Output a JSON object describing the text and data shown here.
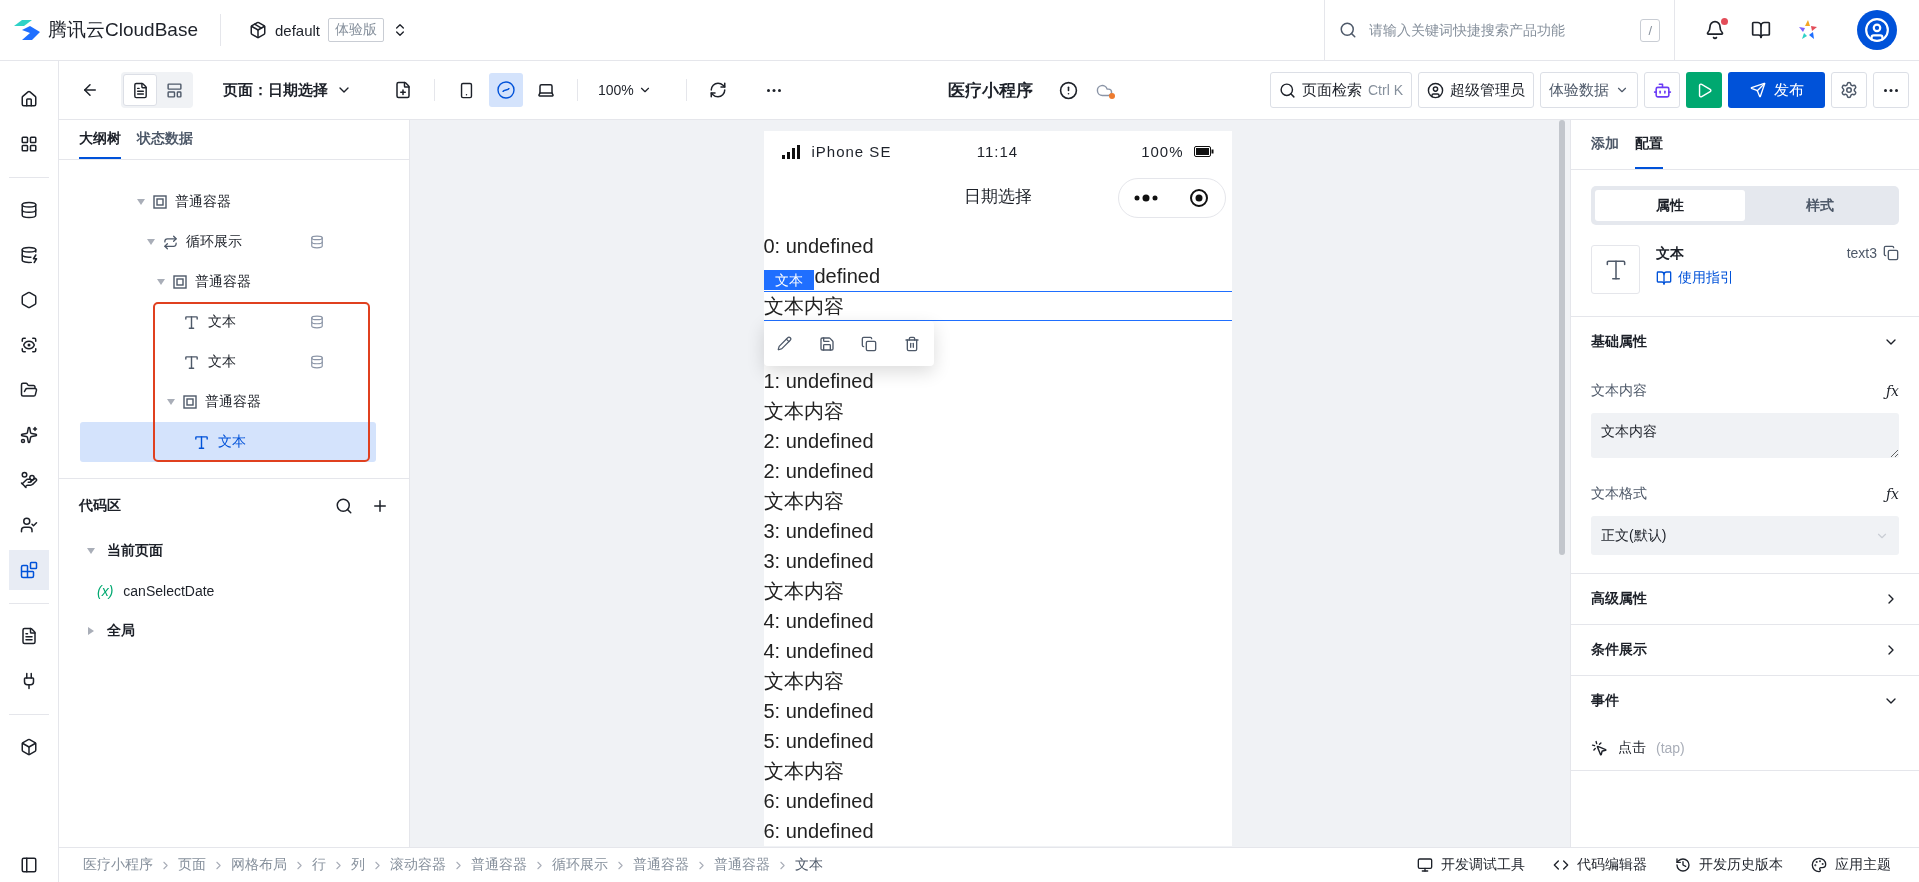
{
  "header": {
    "brand": "腾讯云CloudBase",
    "env": "default",
    "env_badge": "体验版",
    "search": {
      "placeholder": "请输入关键词快捷搜索产品功能",
      "shortcut": "/"
    },
    "notifications_unread": true
  },
  "rail_items": [
    {
      "selected": false
    },
    {
      "selected": false
    },
    {
      "selected": false
    },
    {
      "selected": false
    },
    {
      "selected": false
    },
    {
      "selected": false
    },
    {
      "selected": false
    },
    {
      "selected": false
    },
    {
      "selected": false
    },
    {
      "selected": false
    },
    {
      "selected": true
    },
    {
      "selected": false
    },
    {
      "selected": false
    },
    {
      "selected": false
    }
  ],
  "toolbar": {
    "view_modes": [
      {
        "selected": true
      },
      {
        "selected": false
      }
    ],
    "page_label": "页面：日期选择",
    "devices": [
      {
        "selected": false
      },
      {
        "selected": true
      },
      {
        "selected": false
      }
    ],
    "zoom": "100%",
    "app_title": "医疗小程序",
    "unsaved": true,
    "page_search": {
      "label": "页面检索",
      "shortcut": "Ctrl K"
    },
    "role": "超级管理员",
    "data_source": "体验数据",
    "publish": "发布"
  },
  "outline": {
    "tabs": [
      {
        "label": "大纲树",
        "selected": true
      },
      {
        "label": "状态数据",
        "selected": false
      }
    ],
    "tree": [
      {
        "label": "普通容器",
        "kind": "container",
        "expanded": true,
        "bound": false,
        "selected": false,
        "children": [
          {
            "label": "循环展示",
            "kind": "loop",
            "expanded": true,
            "bound": true,
            "selected": false,
            "children": [
              {
                "label": "普通容器",
                "kind": "container",
                "expanded": true,
                "bound": false,
                "selected": false,
                "annotated": true,
                "children": [
                  {
                    "label": "文本",
                    "kind": "text",
                    "bound": true,
                    "selected": false
                  },
                  {
                    "label": "文本",
                    "kind": "text",
                    "bound": true,
                    "selected": false
                  },
                  {
                    "label": "普通容器",
                    "kind": "container",
                    "expanded": true,
                    "bound": false,
                    "selected": false,
                    "children": [
                      {
                        "label": "文本",
                        "kind": "text",
                        "bound": false,
                        "selected": true
                      }
                    ]
                  }
                ]
              }
            ]
          }
        ]
      }
    ]
  },
  "code_area": {
    "title": "代码区",
    "groups": [
      {
        "label": "当前页面",
        "expanded": true,
        "items": [
          {
            "symbol": "(x)",
            "name": "canSelectDate"
          }
        ]
      },
      {
        "label": "全局",
        "expanded": false
      }
    ]
  },
  "canvas": {
    "device": "iPhone SE",
    "time": "11:14",
    "battery": "100%",
    "page_title": "日期选择",
    "selection_label": "文本",
    "rows": [
      {
        "text": "0: undefined",
        "selected": false
      },
      {
        "text": "defined",
        "selected": false
      },
      {
        "text": "文本内容",
        "selected": true
      },
      {
        "text": "1: undefined",
        "selected": false
      },
      {
        "text": "文本内容",
        "selected": false
      },
      {
        "text": "2: undefined",
        "selected": false
      },
      {
        "text": "2: undefined",
        "selected": false
      },
      {
        "text": "文本内容",
        "selected": false
      },
      {
        "text": "3: undefined",
        "selected": false
      },
      {
        "text": "3: undefined",
        "selected": false
      },
      {
        "text": "文本内容",
        "selected": false
      },
      {
        "text": "4: undefined",
        "selected": false
      },
      {
        "text": "4: undefined",
        "selected": false
      },
      {
        "text": "文本内容",
        "selected": false
      },
      {
        "text": "5: undefined",
        "selected": false
      },
      {
        "text": "5: undefined",
        "selected": false
      },
      {
        "text": "文本内容",
        "selected": false
      },
      {
        "text": "6: undefined",
        "selected": false
      },
      {
        "text": "6: undefined",
        "selected": false
      }
    ]
  },
  "inspector": {
    "tabs": [
      {
        "label": "添加",
        "selected": false
      },
      {
        "label": "配置",
        "selected": true
      }
    ],
    "modes": [
      {
        "label": "属性",
        "selected": true
      },
      {
        "label": "样式",
        "selected": false
      }
    ],
    "component": {
      "name": "文本",
      "guide": "使用指引",
      "id": "text3"
    },
    "sections": [
      {
        "title": "基础属性",
        "expanded": true,
        "fields": [
          {
            "kind": "textarea",
            "label": "文本内容",
            "formula": "ƒx",
            "value": "文本内容"
          },
          {
            "kind": "select",
            "label": "文本格式",
            "formula": "ƒx",
            "value": "正文(默认)"
          }
        ]
      },
      {
        "title": "高级属性",
        "expanded": false
      },
      {
        "title": "条件展示",
        "expanded": false
      },
      {
        "title": "事件",
        "expanded": true,
        "events": [
          {
            "label": "点击",
            "hint": "(tap)"
          }
        ]
      }
    ]
  },
  "bottom_bar": {
    "breadcrumb": [
      {
        "label": "医疗小程序",
        "selected": false
      },
      {
        "label": "页面",
        "selected": false
      },
      {
        "label": "网格布局",
        "selected": false
      },
      {
        "label": "行",
        "selected": false
      },
      {
        "label": "列",
        "selected": false
      },
      {
        "label": "滚动容器",
        "selected": false
      },
      {
        "label": "普通容器",
        "selected": false
      },
      {
        "label": "循环展示",
        "selected": false
      },
      {
        "label": "普通容器",
        "selected": false
      },
      {
        "label": "普通容器",
        "selected": false
      },
      {
        "label": "文本",
        "selected": true
      }
    ],
    "tools": [
      "开发调试工具",
      "代码编辑器",
      "开发历史版本",
      "应用主题"
    ]
  }
}
